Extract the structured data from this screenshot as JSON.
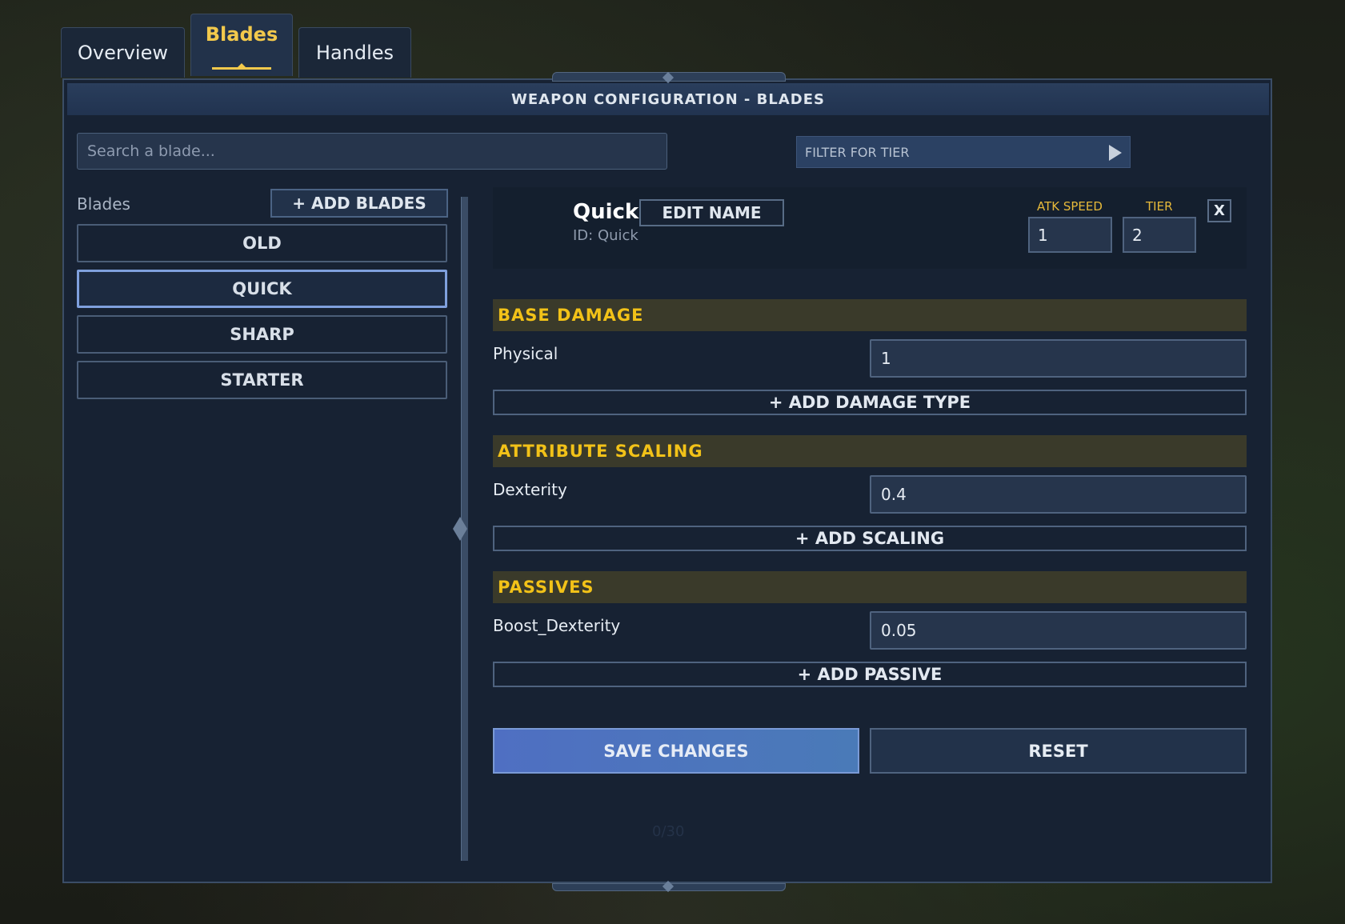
{
  "tabs": [
    {
      "label": "Overview"
    },
    {
      "label": "Blades",
      "active": true
    },
    {
      "label": "Handles"
    }
  ],
  "header": {
    "title": "WEAPON CONFIGURATION - BLADES"
  },
  "search": {
    "placeholder": "Search a blade..."
  },
  "filter": {
    "label": "FILTER FOR TIER"
  },
  "sidebar": {
    "title": "Blades",
    "add_label": "+ ADD BLADES",
    "items": [
      {
        "label": "OLD"
      },
      {
        "label": "QUICK",
        "selected": true
      },
      {
        "label": "SHARP"
      },
      {
        "label": "STARTER"
      }
    ]
  },
  "detail": {
    "name": "Quick",
    "id_text": "ID: Quick",
    "edit_label": "EDIT NAME",
    "atk_speed_label": "ATK SPEED",
    "atk_speed_value": "1",
    "tier_label": "TIER",
    "tier_value": "2",
    "close_label": "X"
  },
  "sections": {
    "base_damage": {
      "title": "BASE DAMAGE",
      "row_label": "Physical",
      "row_value": "1",
      "add_label": "+ ADD DAMAGE TYPE"
    },
    "attribute_scaling": {
      "title": "ATTRIBUTE SCALING",
      "row_label": "Dexterity",
      "row_value": "0.4",
      "add_label": "+ ADD SCALING"
    },
    "passives": {
      "title": "PASSIVES",
      "row_label": "Boost_Dexterity",
      "row_value": "0.05",
      "add_label": "+ ADD PASSIVE"
    }
  },
  "actions": {
    "save_label": "SAVE CHANGES",
    "reset_label": "RESET"
  },
  "counter": "0/30",
  "colors": {
    "panel": "#172233",
    "accent": "#f2c218",
    "save": "#4f6fc2"
  }
}
